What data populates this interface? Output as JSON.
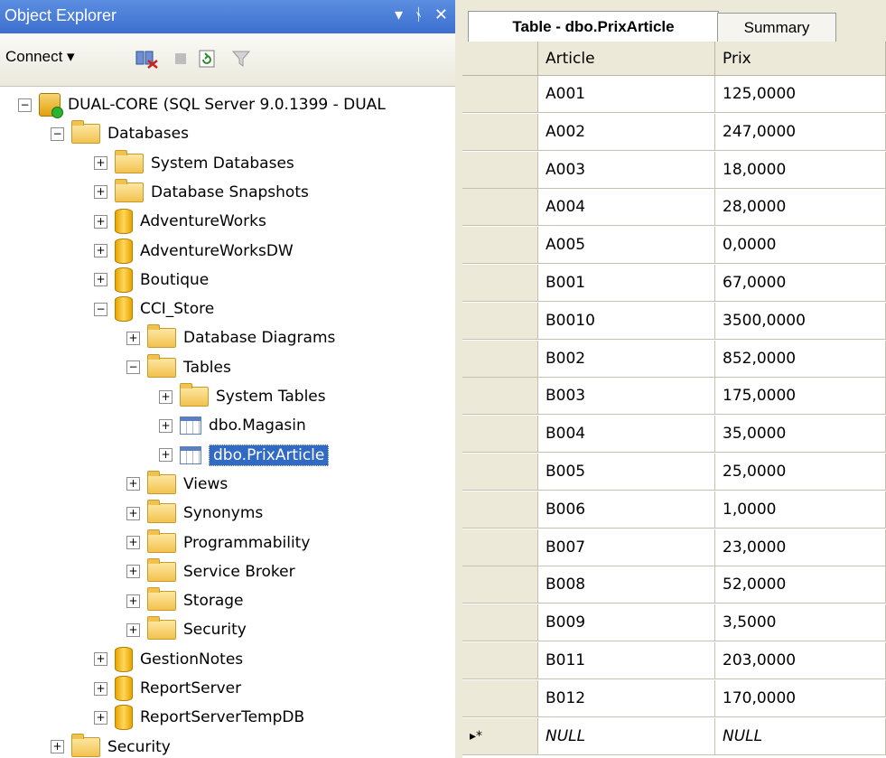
{
  "object_explorer": {
    "title": "Object Explorer",
    "title_buttons": {
      "dropdown": "▾",
      "pin": "ᛀ",
      "close": "✕"
    },
    "toolbar": {
      "connect_label": "Connect ▾"
    },
    "tree": [
      {
        "label": "DUAL-CORE (SQL Server 9.0.1399 - DUAL",
        "icon": "server",
        "toggle": "−",
        "level": 0
      },
      {
        "label": "Databases",
        "icon": "folder",
        "toggle": "−",
        "level": 1
      },
      {
        "label": "System Databases",
        "icon": "folder",
        "toggle": "+",
        "level": 2
      },
      {
        "label": "Database Snapshots",
        "icon": "folder",
        "toggle": "+",
        "level": 2
      },
      {
        "label": "AdventureWorks",
        "icon": "database",
        "toggle": "+",
        "level": 2
      },
      {
        "label": "AdventureWorksDW",
        "icon": "database",
        "toggle": "+",
        "level": 2
      },
      {
        "label": "Boutique",
        "icon": "database",
        "toggle": "+",
        "level": 2
      },
      {
        "label": "CCI_Store",
        "icon": "database",
        "toggle": "−",
        "level": 2
      },
      {
        "label": "Database Diagrams",
        "icon": "folder",
        "toggle": "+",
        "level": 3
      },
      {
        "label": "Tables",
        "icon": "folder",
        "toggle": "−",
        "level": 3
      },
      {
        "label": "System Tables",
        "icon": "folder",
        "toggle": "+",
        "level": 4
      },
      {
        "label": "dbo.Magasin",
        "icon": "table",
        "toggle": "+",
        "level": 4
      },
      {
        "label": "dbo.PrixArticle",
        "icon": "table",
        "toggle": "+",
        "level": 4,
        "selected": true
      },
      {
        "label": "Views",
        "icon": "folder",
        "toggle": "+",
        "level": 3
      },
      {
        "label": "Synonyms",
        "icon": "folder",
        "toggle": "+",
        "level": 3
      },
      {
        "label": "Programmability",
        "icon": "folder",
        "toggle": "+",
        "level": 3
      },
      {
        "label": "Service Broker",
        "icon": "folder",
        "toggle": "+",
        "level": 3
      },
      {
        "label": "Storage",
        "icon": "folder",
        "toggle": "+",
        "level": 3
      },
      {
        "label": "Security",
        "icon": "folder",
        "toggle": "+",
        "level": 3
      },
      {
        "label": "GestionNotes",
        "icon": "database",
        "toggle": "+",
        "level": 2
      },
      {
        "label": "ReportServer",
        "icon": "database",
        "toggle": "+",
        "level": 2
      },
      {
        "label": "ReportServerTempDB",
        "icon": "database",
        "toggle": "+",
        "level": 2
      },
      {
        "label": "Security",
        "icon": "folder",
        "toggle": "+",
        "level": 1
      }
    ]
  },
  "editor": {
    "tabs": [
      {
        "label": "Table - dbo.PrixArticle",
        "active": true
      },
      {
        "label": "Summary",
        "active": false
      }
    ],
    "columns": [
      "Article",
      "Prix"
    ],
    "rows": [
      [
        "A001",
        "125,0000"
      ],
      [
        "A002",
        "247,0000"
      ],
      [
        "A003",
        "18,0000"
      ],
      [
        "A004",
        "28,0000"
      ],
      [
        "A005",
        "0,0000"
      ],
      [
        "B001",
        "67,0000"
      ],
      [
        "B0010",
        "3500,0000"
      ],
      [
        "B002",
        "852,0000"
      ],
      [
        "B003",
        "175,0000"
      ],
      [
        "B004",
        "35,0000"
      ],
      [
        "B005",
        "25,0000"
      ],
      [
        "B006",
        "1,0000"
      ],
      [
        "B007",
        "23,0000"
      ],
      [
        "B008",
        "52,0000"
      ],
      [
        "B009",
        "3,5000"
      ],
      [
        "B011",
        "203,0000"
      ],
      [
        "B012",
        "170,0000"
      ]
    ],
    "new_row": {
      "marker": "▸*",
      "values": [
        "NULL",
        "NULL"
      ]
    }
  },
  "colors": {
    "title_bar": "#3d6fcf",
    "selection": "#316ac5",
    "chrome": "#ece9d8"
  }
}
